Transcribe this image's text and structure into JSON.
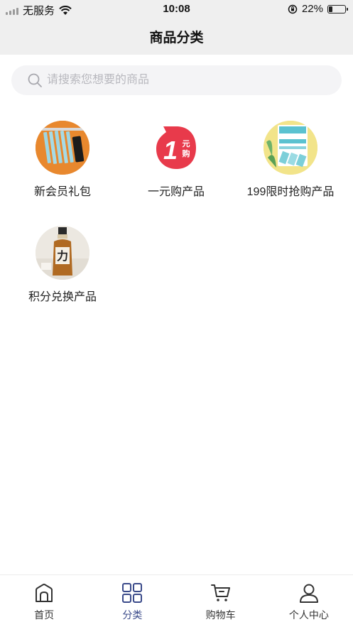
{
  "status_bar": {
    "carrier": "无服务",
    "time": "10:08",
    "battery": "22%",
    "battery_level": 0.22
  },
  "nav": {
    "title": "商品分类"
  },
  "search": {
    "placeholder": "请搜索您想要的商品",
    "value": ""
  },
  "categories": [
    {
      "label": "新会员礼包",
      "icon": "sachet-pack-image"
    },
    {
      "label": "一元购产品",
      "icon": "one-yuan-badge-image",
      "badge_number": "1",
      "badge_text": "元购",
      "badge_color": "#e83a4b"
    },
    {
      "label": "199限时抢购产品",
      "icon": "probiotic-box-image"
    },
    {
      "label": "积分兑换产品",
      "icon": "liquor-bottle-image",
      "bottle_mark": "力"
    }
  ],
  "tabs": [
    {
      "label": "首页",
      "icon": "home-icon",
      "active": false
    },
    {
      "label": "分类",
      "icon": "grid-icon",
      "active": true
    },
    {
      "label": "购物车",
      "icon": "cart-icon",
      "active": false
    },
    {
      "label": "个人中心",
      "icon": "user-icon",
      "active": false
    }
  ],
  "colors": {
    "active_tab": "#3a4a8a",
    "header_bg": "#efefef",
    "search_bg": "#f4f4f6"
  }
}
